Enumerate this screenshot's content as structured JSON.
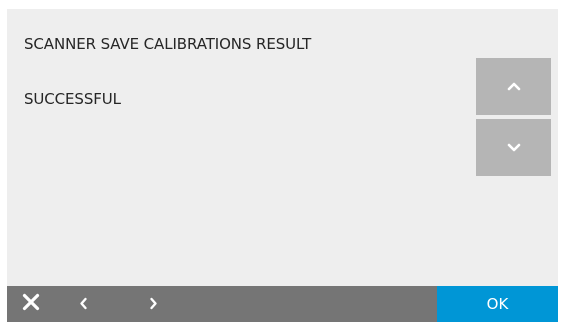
{
  "dialog": {
    "title": "SCANNER SAVE CALIBRATIONS RESULT",
    "result": "SUCCESSFUL"
  },
  "scroll": {
    "up_icon": "chevron-up-icon",
    "down_icon": "chevron-down-icon"
  },
  "bottom_bar": {
    "close_icon": "close-icon",
    "prev_icon": "chevron-left-icon",
    "next_icon": "chevron-right-icon",
    "ok_label": "OK"
  },
  "colors": {
    "background": "#eeeeee",
    "scroll_button": "#b5b5b5",
    "bottom_bar": "#757575",
    "ok_button": "#0096d6",
    "text": "#262626"
  }
}
